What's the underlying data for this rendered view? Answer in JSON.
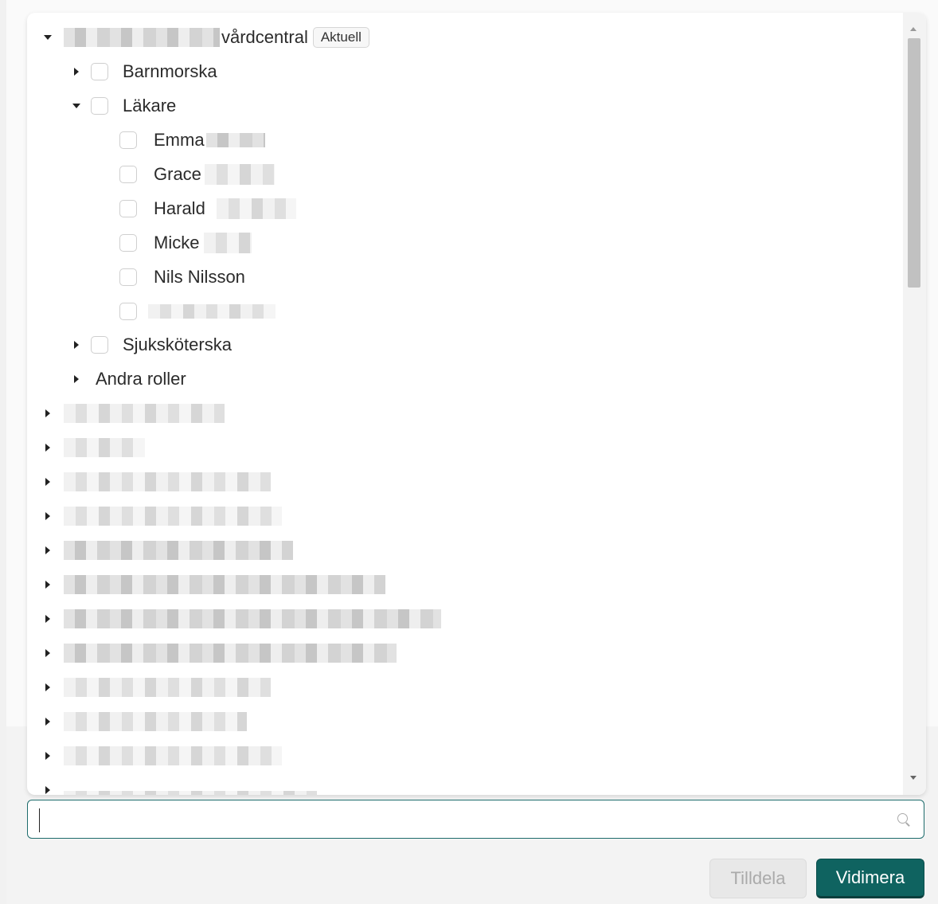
{
  "tree": {
    "root": {
      "label": "vårdcentral",
      "badge": "Aktuell"
    },
    "groups": [
      {
        "label": "Barnmorska"
      },
      {
        "label": "Läkare"
      },
      {
        "label": "Sjuksköterska"
      },
      {
        "label": "Andra roller"
      }
    ],
    "lakare_members": [
      {
        "label": "Emma"
      },
      {
        "label": "Grace"
      },
      {
        "label": "Harald"
      },
      {
        "label": "Micke"
      },
      {
        "label": "Nils Nilsson"
      },
      {
        "label": ""
      }
    ]
  },
  "search": {
    "value": "",
    "placeholder": ""
  },
  "buttons": {
    "assign_label": "Tilldela",
    "verify_label": "Vidimera"
  },
  "colors": {
    "primary": "#0f6360",
    "search_border": "#1d6b6b",
    "disabled_bg": "#e8e8e8",
    "disabled_text": "#aaaaaa"
  },
  "icons": {
    "expanded": "caret-down-icon",
    "collapsed": "caret-right-icon",
    "search": "search-icon"
  }
}
